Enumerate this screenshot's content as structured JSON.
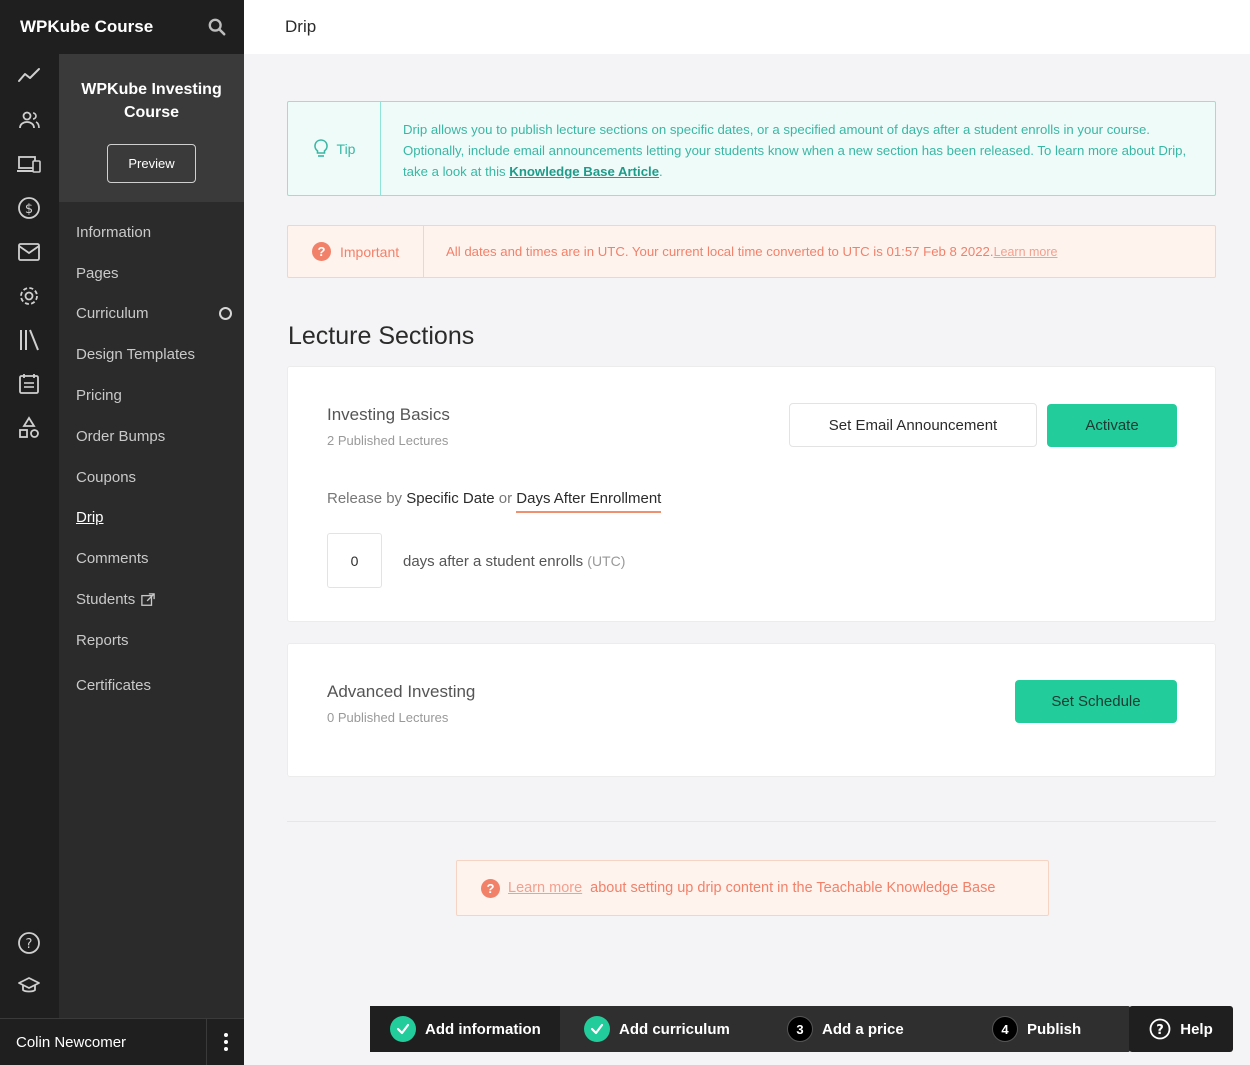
{
  "app": {
    "title": "WPKube Course"
  },
  "header": {
    "title": "Drip"
  },
  "rail_icons": [
    "analytics-icon",
    "users-icon",
    "devices-icon",
    "dollar-icon",
    "mail-icon",
    "gear-icon",
    "library-icon",
    "calendar-icon",
    "shapes-icon",
    "help-circle-icon",
    "graduation-cap-icon"
  ],
  "course": {
    "name": "WPKube Investing Course",
    "preview_label": "Preview"
  },
  "nav": {
    "information": "Information",
    "pages": "Pages",
    "curriculum": "Curriculum",
    "design_templates": "Design Templates",
    "pricing": "Pricing",
    "order_bumps": "Order Bumps",
    "coupons": "Coupons",
    "drip": "Drip",
    "comments": "Comments",
    "students": "Students",
    "reports": "Reports",
    "certificates": "Certificates",
    "active": "Drip"
  },
  "user": {
    "name": "Colin Newcomer"
  },
  "tip": {
    "label": "Tip",
    "text": "Drip allows you to publish lecture sections on specific dates, or a specified amount of days after a student enrolls in your course. Optionally, include email announcements letting your students know when a new section has been released. To learn more about Drip, take a look at this ",
    "link": "Knowledge Base Article",
    "end": "."
  },
  "important": {
    "label": "Important",
    "text": "All dates and times are in UTC. Your current local time converted to UTC is 01:57 Feb 8 2022.",
    "link": "Learn more"
  },
  "lecture_sections": {
    "title": "Lecture Sections",
    "sections": [
      {
        "title": "Investing Basics",
        "published": "2 Published  Lectures",
        "email_button": "Set Email Announcement",
        "action_button": "Activate",
        "release_prefix": "Release by",
        "option_date": "Specific Date",
        "or": "or",
        "option_days": "Days After Enrollment",
        "selected_option": "Days After Enrollment",
        "days_value": "0",
        "days_text": "days after a student enrolls",
        "utc": "(UTC)"
      },
      {
        "title": "Advanced Investing",
        "published": "0 Published  Lectures",
        "action_button": "Set Schedule"
      }
    ]
  },
  "kb_notice": {
    "link": "Learn more",
    "text": "about setting up drip content in the Teachable Knowledge Base"
  },
  "setup_steps": [
    {
      "label": "Add information",
      "status": "done"
    },
    {
      "label": "Add curriculum",
      "status": "done"
    },
    {
      "number": "3",
      "label": "Add a price",
      "status": "todo"
    },
    {
      "number": "4",
      "label": "Publish",
      "status": "todo"
    }
  ],
  "help": {
    "label": "Help"
  },
  "colors": {
    "accent_green": "#23cc9b",
    "tip_teal": "#3ab7a4",
    "warning_coral": "#f2816a",
    "sidebar_dark": "#1f1f1f"
  }
}
